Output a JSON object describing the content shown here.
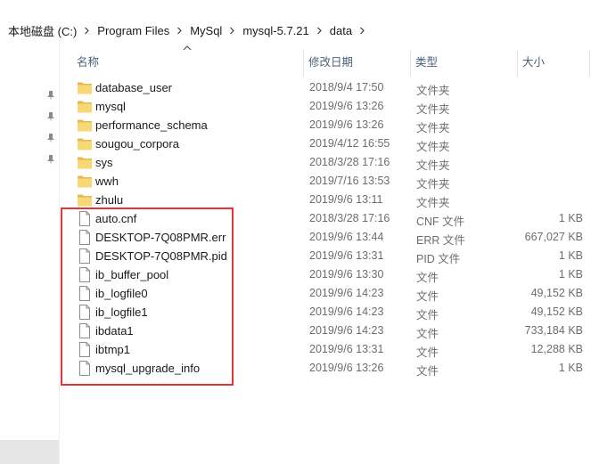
{
  "breadcrumb": [
    {
      "label": "本地磁盘 (C:)"
    },
    {
      "label": "Program Files"
    },
    {
      "label": "MySql"
    },
    {
      "label": "mysql-5.7.21"
    },
    {
      "label": "data"
    }
  ],
  "columns": {
    "name": "名称",
    "date": "修改日期",
    "type": "类型",
    "size": "大小"
  },
  "files": [
    {
      "name": "database_user",
      "date": "2018/9/4 17:50",
      "type": "文件夹",
      "size": "",
      "kind": "folder"
    },
    {
      "name": "mysql",
      "date": "2019/9/6 13:26",
      "type": "文件夹",
      "size": "",
      "kind": "folder"
    },
    {
      "name": "performance_schema",
      "date": "2019/9/6 13:26",
      "type": "文件夹",
      "size": "",
      "kind": "folder"
    },
    {
      "name": "sougou_corpora",
      "date": "2019/4/12 16:55",
      "type": "文件夹",
      "size": "",
      "kind": "folder"
    },
    {
      "name": "sys",
      "date": "2018/3/28 17:16",
      "type": "文件夹",
      "size": "",
      "kind": "folder"
    },
    {
      "name": "wwh",
      "date": "2019/7/16 13:53",
      "type": "文件夹",
      "size": "",
      "kind": "folder"
    },
    {
      "name": "zhulu",
      "date": "2019/9/6 13:11",
      "type": "文件夹",
      "size": "",
      "kind": "folder"
    },
    {
      "name": "auto.cnf",
      "date": "2018/3/28 17:16",
      "type": "CNF 文件",
      "size": "1 KB",
      "kind": "file"
    },
    {
      "name": "DESKTOP-7Q08PMR.err",
      "date": "2019/9/6 13:44",
      "type": "ERR 文件",
      "size": "667,027 KB",
      "kind": "file"
    },
    {
      "name": "DESKTOP-7Q08PMR.pid",
      "date": "2019/9/6 13:31",
      "type": "PID 文件",
      "size": "1 KB",
      "kind": "file"
    },
    {
      "name": "ib_buffer_pool",
      "date": "2019/9/6 13:30",
      "type": "文件",
      "size": "1 KB",
      "kind": "file"
    },
    {
      "name": "ib_logfile0",
      "date": "2019/9/6 14:23",
      "type": "文件",
      "size": "49,152 KB",
      "kind": "file"
    },
    {
      "name": "ib_logfile1",
      "date": "2019/9/6 14:23",
      "type": "文件",
      "size": "49,152 KB",
      "kind": "file"
    },
    {
      "name": "ibdata1",
      "date": "2019/9/6 14:23",
      "type": "文件",
      "size": "733,184 KB",
      "kind": "file"
    },
    {
      "name": "ibtmp1",
      "date": "2019/9/6 13:31",
      "type": "文件",
      "size": "12,288 KB",
      "kind": "file"
    },
    {
      "name": "mysql_upgrade_info",
      "date": "2019/9/6 13:26",
      "type": "文件",
      "size": "1 KB",
      "kind": "file"
    }
  ],
  "colors": {
    "folder": "#f8d775",
    "folder_dark": "#e8b84a",
    "highlight": "#e53434",
    "header_text": "#4c607a"
  },
  "icons": {
    "folder": "folder-icon",
    "file": "file-icon",
    "pin": "pin-icon",
    "separator": "chevron-right-icon",
    "sort": "sort-ascending-icon"
  }
}
